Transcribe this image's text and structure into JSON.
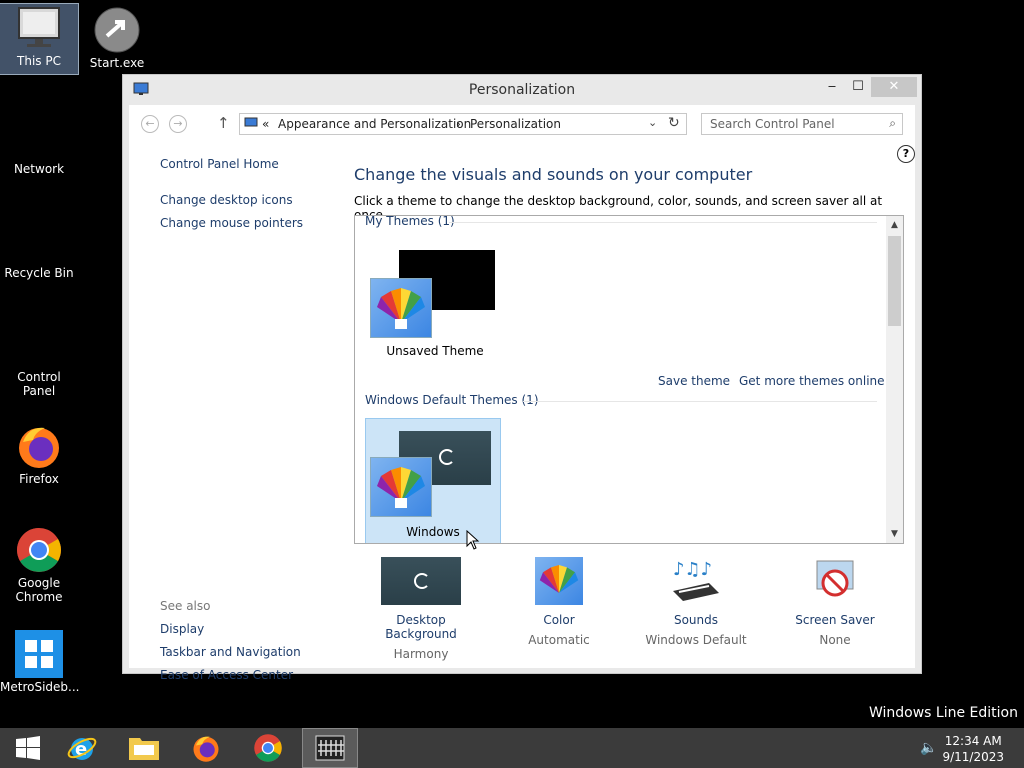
{
  "desktop": {
    "icons": [
      "This PC",
      "Start.exe",
      "Network",
      "Recycle Bin",
      "Control Panel",
      "Firefox",
      "Google Chrome",
      "MetroSideb..."
    ],
    "edition": "Windows Line Edition"
  },
  "window": {
    "title": "Personalization",
    "controls": {
      "minimize": "‒",
      "maximize": "☐",
      "close": "✕"
    }
  },
  "address": {
    "crumbs": [
      "«",
      "Appearance and Personalization",
      "›",
      "Personalization"
    ],
    "search_placeholder": "Search Control Panel"
  },
  "left_pane": {
    "links": [
      "Control Panel Home",
      "Change desktop icons",
      "Change mouse pointers"
    ],
    "see_also_label": "See also",
    "see_also": [
      "Display",
      "Taskbar and Navigation",
      "Ease of Access Center"
    ]
  },
  "main": {
    "heading": "Change the visuals and sounds on your computer",
    "subtext": "Click a theme to change the desktop background, color, sounds, and screen saver all at once.",
    "my_themes_label": "My Themes (1)",
    "unsaved_theme": "Unsaved Theme",
    "save_theme": "Save theme",
    "get_more": "Get more themes online",
    "default_label": "Windows Default Themes (1)",
    "windows_theme": "Windows"
  },
  "options": [
    {
      "name": "Desktop Background",
      "value": "Harmony"
    },
    {
      "name": "Color",
      "value": "Automatic"
    },
    {
      "name": "Sounds",
      "value": "Windows Default"
    },
    {
      "name": "Screen Saver",
      "value": "None"
    }
  ],
  "taskbar": {
    "time": "12:34 AM",
    "date": "9/11/2023"
  }
}
